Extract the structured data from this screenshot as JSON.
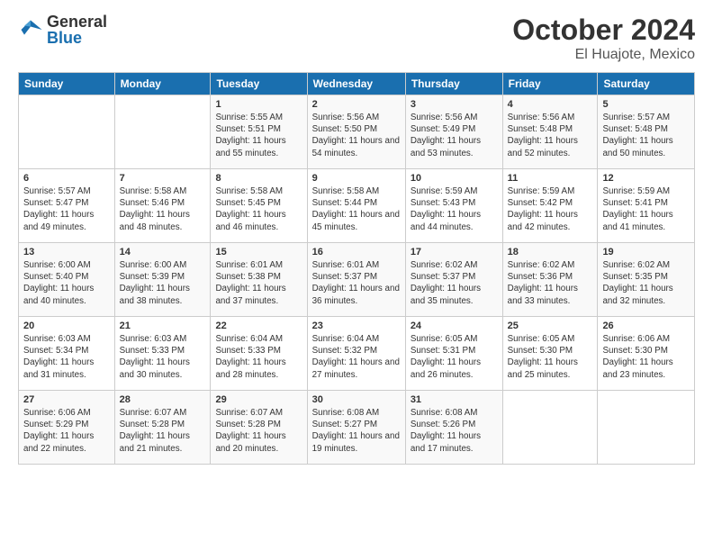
{
  "header": {
    "logo_general": "General",
    "logo_blue": "Blue",
    "month_title": "October 2024",
    "location": "El Huajote, Mexico"
  },
  "days_of_week": [
    "Sunday",
    "Monday",
    "Tuesday",
    "Wednesday",
    "Thursday",
    "Friday",
    "Saturday"
  ],
  "weeks": [
    [
      {
        "day": "",
        "info": ""
      },
      {
        "day": "",
        "info": ""
      },
      {
        "day": "1",
        "info": "Sunrise: 5:55 AM\nSunset: 5:51 PM\nDaylight: 11 hours and 55 minutes."
      },
      {
        "day": "2",
        "info": "Sunrise: 5:56 AM\nSunset: 5:50 PM\nDaylight: 11 hours and 54 minutes."
      },
      {
        "day": "3",
        "info": "Sunrise: 5:56 AM\nSunset: 5:49 PM\nDaylight: 11 hours and 53 minutes."
      },
      {
        "day": "4",
        "info": "Sunrise: 5:56 AM\nSunset: 5:48 PM\nDaylight: 11 hours and 52 minutes."
      },
      {
        "day": "5",
        "info": "Sunrise: 5:57 AM\nSunset: 5:48 PM\nDaylight: 11 hours and 50 minutes."
      }
    ],
    [
      {
        "day": "6",
        "info": "Sunrise: 5:57 AM\nSunset: 5:47 PM\nDaylight: 11 hours and 49 minutes."
      },
      {
        "day": "7",
        "info": "Sunrise: 5:58 AM\nSunset: 5:46 PM\nDaylight: 11 hours and 48 minutes."
      },
      {
        "day": "8",
        "info": "Sunrise: 5:58 AM\nSunset: 5:45 PM\nDaylight: 11 hours and 46 minutes."
      },
      {
        "day": "9",
        "info": "Sunrise: 5:58 AM\nSunset: 5:44 PM\nDaylight: 11 hours and 45 minutes."
      },
      {
        "day": "10",
        "info": "Sunrise: 5:59 AM\nSunset: 5:43 PM\nDaylight: 11 hours and 44 minutes."
      },
      {
        "day": "11",
        "info": "Sunrise: 5:59 AM\nSunset: 5:42 PM\nDaylight: 11 hours and 42 minutes."
      },
      {
        "day": "12",
        "info": "Sunrise: 5:59 AM\nSunset: 5:41 PM\nDaylight: 11 hours and 41 minutes."
      }
    ],
    [
      {
        "day": "13",
        "info": "Sunrise: 6:00 AM\nSunset: 5:40 PM\nDaylight: 11 hours and 40 minutes."
      },
      {
        "day": "14",
        "info": "Sunrise: 6:00 AM\nSunset: 5:39 PM\nDaylight: 11 hours and 38 minutes."
      },
      {
        "day": "15",
        "info": "Sunrise: 6:01 AM\nSunset: 5:38 PM\nDaylight: 11 hours and 37 minutes."
      },
      {
        "day": "16",
        "info": "Sunrise: 6:01 AM\nSunset: 5:37 PM\nDaylight: 11 hours and 36 minutes."
      },
      {
        "day": "17",
        "info": "Sunrise: 6:02 AM\nSunset: 5:37 PM\nDaylight: 11 hours and 35 minutes."
      },
      {
        "day": "18",
        "info": "Sunrise: 6:02 AM\nSunset: 5:36 PM\nDaylight: 11 hours and 33 minutes."
      },
      {
        "day": "19",
        "info": "Sunrise: 6:02 AM\nSunset: 5:35 PM\nDaylight: 11 hours and 32 minutes."
      }
    ],
    [
      {
        "day": "20",
        "info": "Sunrise: 6:03 AM\nSunset: 5:34 PM\nDaylight: 11 hours and 31 minutes."
      },
      {
        "day": "21",
        "info": "Sunrise: 6:03 AM\nSunset: 5:33 PM\nDaylight: 11 hours and 30 minutes."
      },
      {
        "day": "22",
        "info": "Sunrise: 6:04 AM\nSunset: 5:33 PM\nDaylight: 11 hours and 28 minutes."
      },
      {
        "day": "23",
        "info": "Sunrise: 6:04 AM\nSunset: 5:32 PM\nDaylight: 11 hours and 27 minutes."
      },
      {
        "day": "24",
        "info": "Sunrise: 6:05 AM\nSunset: 5:31 PM\nDaylight: 11 hours and 26 minutes."
      },
      {
        "day": "25",
        "info": "Sunrise: 6:05 AM\nSunset: 5:30 PM\nDaylight: 11 hours and 25 minutes."
      },
      {
        "day": "26",
        "info": "Sunrise: 6:06 AM\nSunset: 5:30 PM\nDaylight: 11 hours and 23 minutes."
      }
    ],
    [
      {
        "day": "27",
        "info": "Sunrise: 6:06 AM\nSunset: 5:29 PM\nDaylight: 11 hours and 22 minutes."
      },
      {
        "day": "28",
        "info": "Sunrise: 6:07 AM\nSunset: 5:28 PM\nDaylight: 11 hours and 21 minutes."
      },
      {
        "day": "29",
        "info": "Sunrise: 6:07 AM\nSunset: 5:28 PM\nDaylight: 11 hours and 20 minutes."
      },
      {
        "day": "30",
        "info": "Sunrise: 6:08 AM\nSunset: 5:27 PM\nDaylight: 11 hours and 19 minutes."
      },
      {
        "day": "31",
        "info": "Sunrise: 6:08 AM\nSunset: 5:26 PM\nDaylight: 11 hours and 17 minutes."
      },
      {
        "day": "",
        "info": ""
      },
      {
        "day": "",
        "info": ""
      }
    ]
  ]
}
